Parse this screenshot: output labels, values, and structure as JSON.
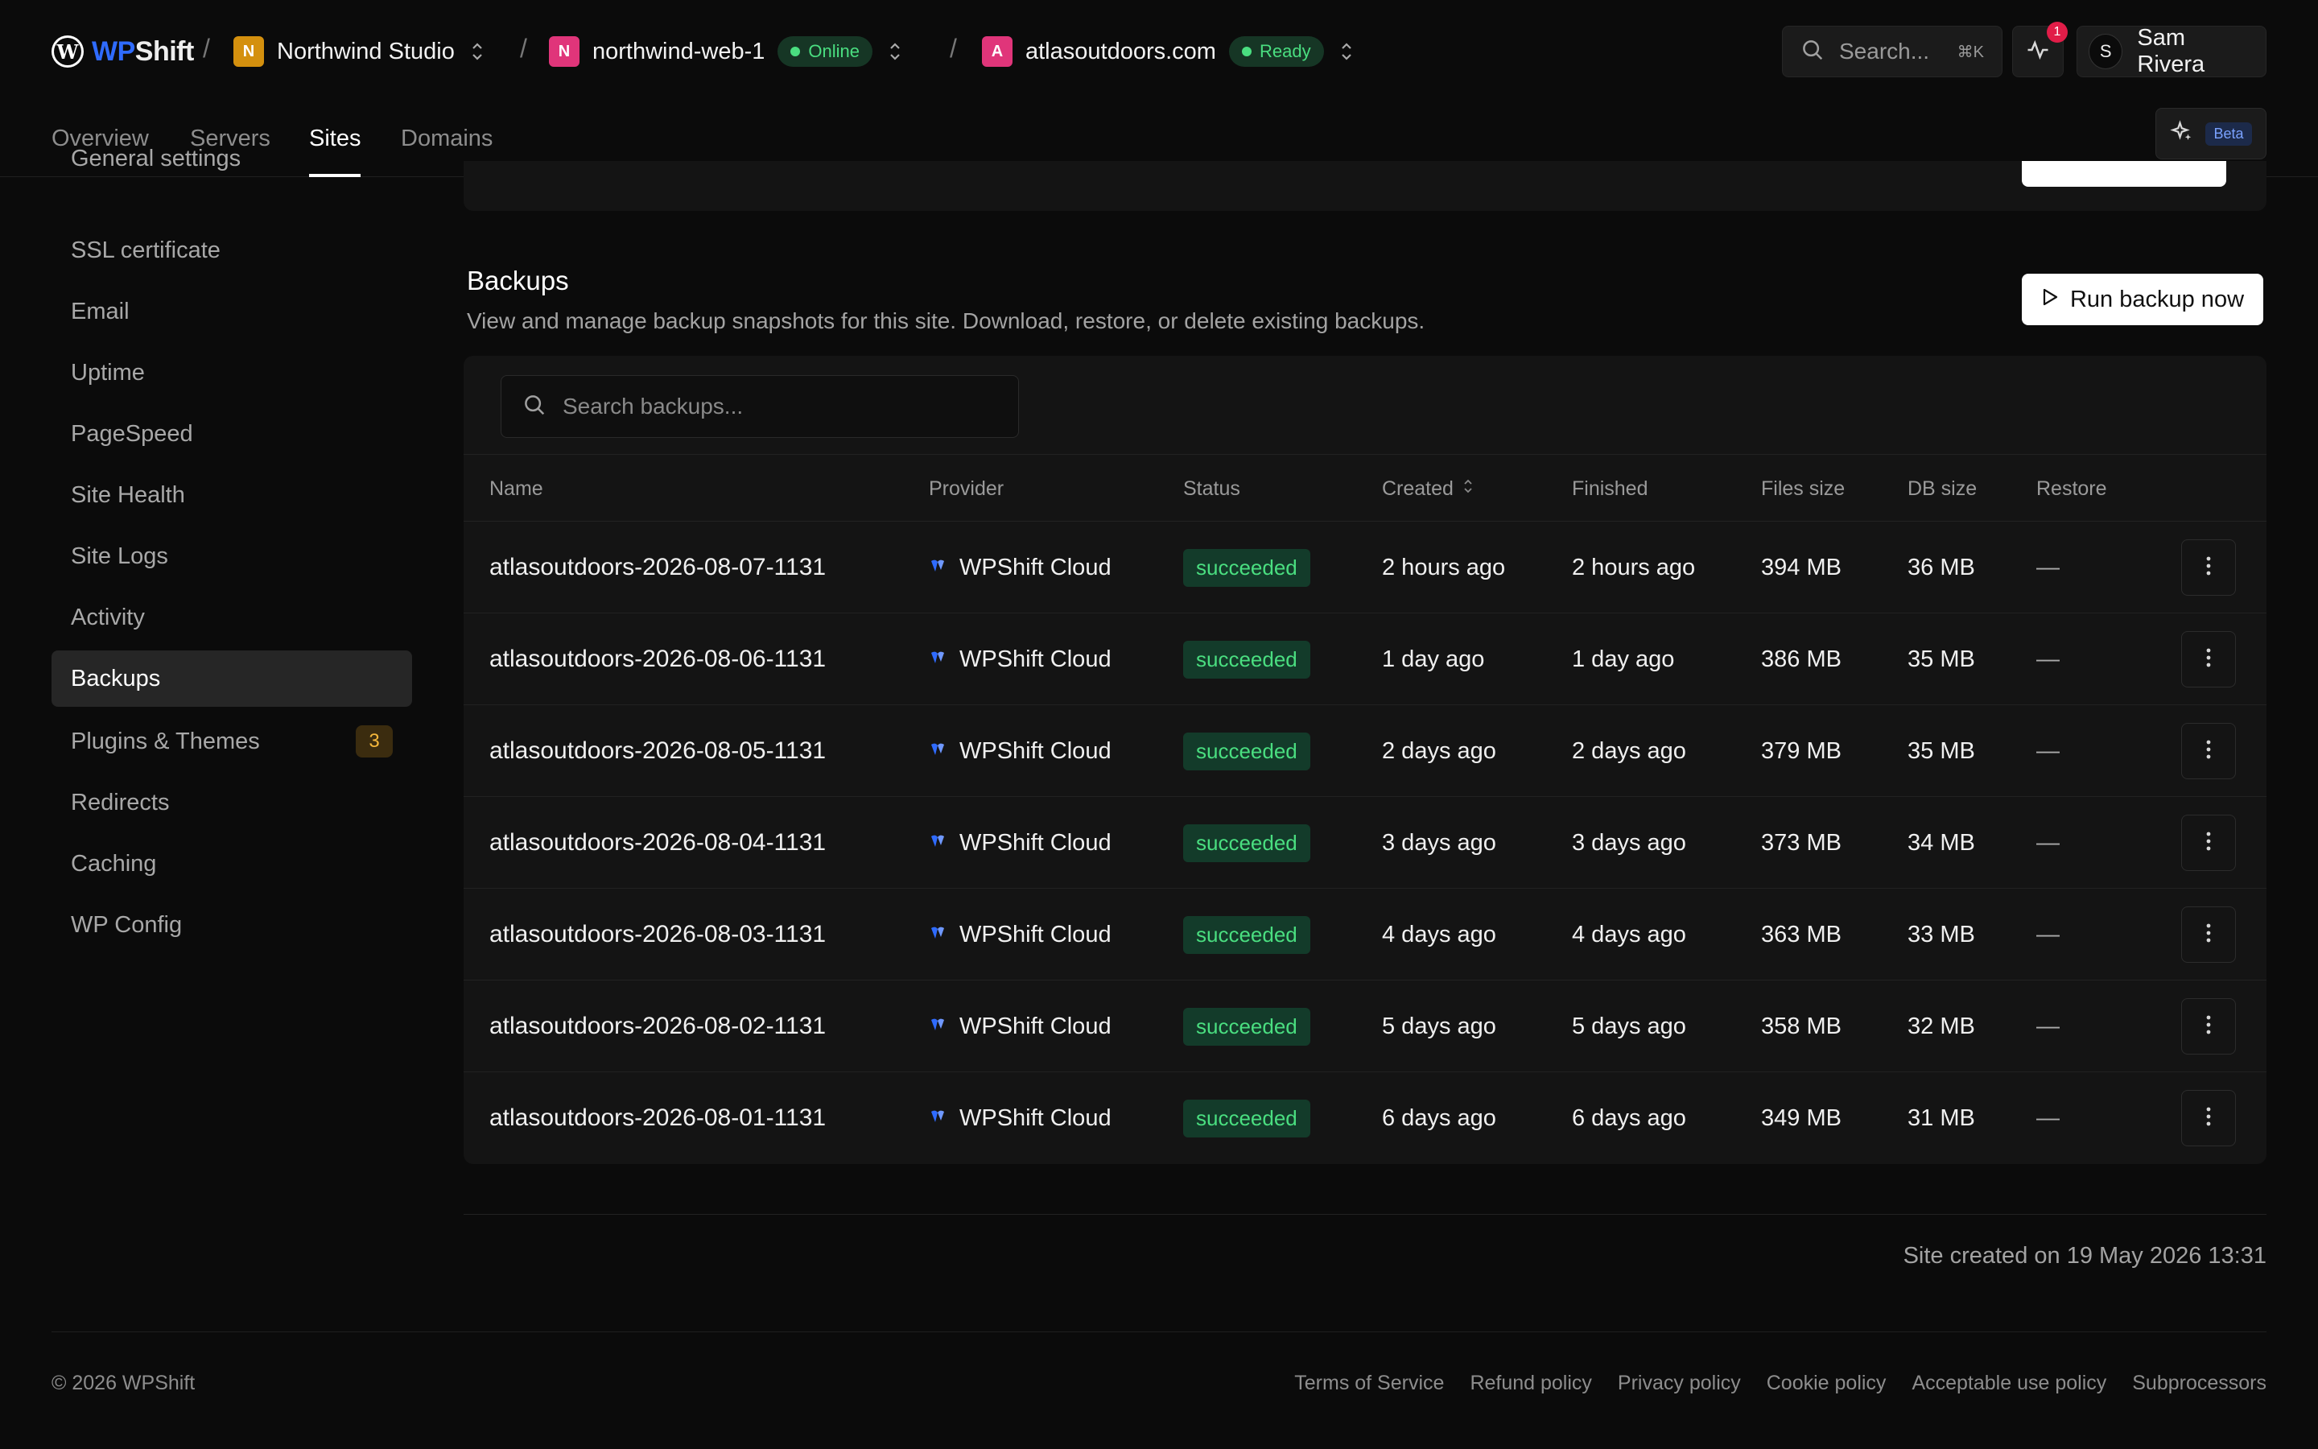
{
  "app": {
    "brand_prefix": "WP",
    "brand_suffix": "Shift",
    "brand_color": "#2f6bff"
  },
  "breadcrumbs": [
    {
      "avatar": "N",
      "label": "Northwind Studio",
      "avatar_color": "#d4900e"
    },
    {
      "avatar": "N",
      "label": "northwind-web-1",
      "status": "Online",
      "avatar_color": "#e0357a"
    },
    {
      "avatar": "A",
      "label": "atlasoutdoors.com",
      "status": "Ready",
      "avatar_color": "#e0357a"
    }
  ],
  "header": {
    "search_placeholder": "Search...",
    "search_shortcut": "⌘K",
    "notifications_count": "1",
    "user_initial": "S",
    "user_name": "Sam Rivera"
  },
  "tabs": [
    {
      "label": "Overview",
      "active": false
    },
    {
      "label": "Servers",
      "active": false
    },
    {
      "label": "Sites",
      "active": true
    },
    {
      "label": "Domains",
      "active": false
    }
  ],
  "beta_label": "Beta",
  "sidebar": {
    "items": [
      {
        "label": "General settings"
      },
      {
        "label": "SSL certificate"
      },
      {
        "label": "Email"
      },
      {
        "label": "Uptime"
      },
      {
        "label": "PageSpeed"
      },
      {
        "label": "Site Health"
      },
      {
        "label": "Site Logs"
      },
      {
        "label": "Activity"
      },
      {
        "label": "Backups",
        "active": true
      },
      {
        "label": "Plugins & Themes",
        "count": "3"
      },
      {
        "label": "Redirects"
      },
      {
        "label": "Caching"
      },
      {
        "label": "WP Config"
      }
    ]
  },
  "backups": {
    "title": "Backups",
    "description": "View and manage backup snapshots for this site. Download, restore, or delete existing backups.",
    "run_button": "Run backup now",
    "search_placeholder": "Search backups...",
    "columns": {
      "name": "Name",
      "provider": "Provider",
      "status": "Status",
      "created": "Created",
      "finished": "Finished",
      "files_size": "Files size",
      "db_size": "DB size",
      "restore": "Restore"
    },
    "rows": [
      {
        "name": "atlasoutdoors-2026-08-07-1131",
        "provider": "WPShift Cloud",
        "status": "succeeded",
        "created": "2 hours ago",
        "finished": "2 hours ago",
        "files_size": "394 MB",
        "db_size": "36 MB",
        "restore": "—"
      },
      {
        "name": "atlasoutdoors-2026-08-06-1131",
        "provider": "WPShift Cloud",
        "status": "succeeded",
        "created": "1 day ago",
        "finished": "1 day ago",
        "files_size": "386 MB",
        "db_size": "35 MB",
        "restore": "—"
      },
      {
        "name": "atlasoutdoors-2026-08-05-1131",
        "provider": "WPShift Cloud",
        "status": "succeeded",
        "created": "2 days ago",
        "finished": "2 days ago",
        "files_size": "379 MB",
        "db_size": "35 MB",
        "restore": "—"
      },
      {
        "name": "atlasoutdoors-2026-08-04-1131",
        "provider": "WPShift Cloud",
        "status": "succeeded",
        "created": "3 days ago",
        "finished": "3 days ago",
        "files_size": "373 MB",
        "db_size": "34 MB",
        "restore": "—"
      },
      {
        "name": "atlasoutdoors-2026-08-03-1131",
        "provider": "WPShift Cloud",
        "status": "succeeded",
        "created": "4 days ago",
        "finished": "4 days ago",
        "files_size": "363 MB",
        "db_size": "33 MB",
        "restore": "—"
      },
      {
        "name": "atlasoutdoors-2026-08-02-1131",
        "provider": "WPShift Cloud",
        "status": "succeeded",
        "created": "5 days ago",
        "finished": "5 days ago",
        "files_size": "358 MB",
        "db_size": "32 MB",
        "restore": "—"
      },
      {
        "name": "atlasoutdoors-2026-08-01-1131",
        "provider": "WPShift Cloud",
        "status": "succeeded",
        "created": "6 days ago",
        "finished": "6 days ago",
        "files_size": "349 MB",
        "db_size": "31 MB",
        "restore": "—"
      }
    ]
  },
  "site_created": "Site created on 19 May 2026 13:31",
  "footer": {
    "copyright": "© 2026 WPShift",
    "links": [
      "Terms of Service",
      "Refund policy",
      "Privacy policy",
      "Cookie policy",
      "Acceptable use policy",
      "Subprocessors"
    ]
  }
}
